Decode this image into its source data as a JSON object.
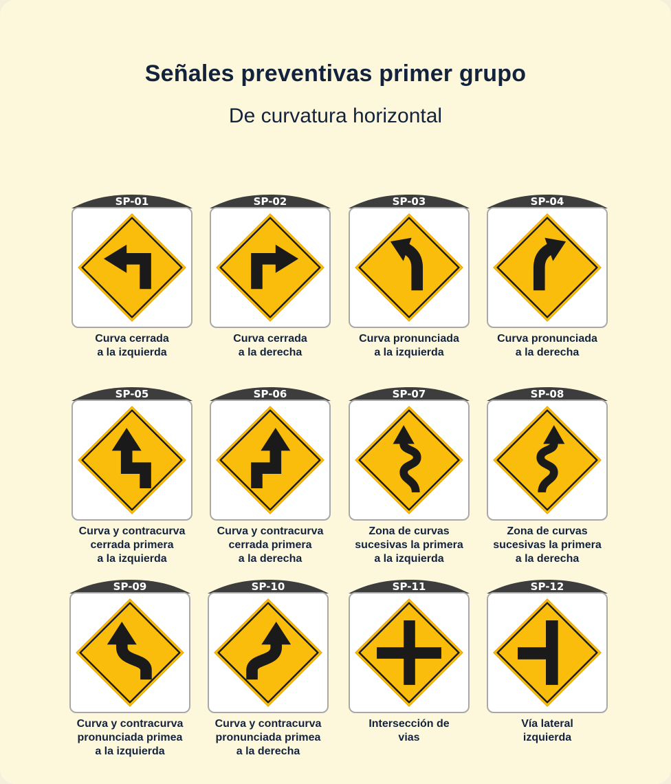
{
  "header": {
    "title": "Señales preventivas primer grupo",
    "subtitle": "De curvatura horizontal"
  },
  "colors": {
    "sign_yellow": "#fbbd0c",
    "sign_symbol": "#1a1a1a",
    "tab": "#3d3d3d",
    "background": "#fdf8db",
    "text": "#13233e"
  },
  "signs": [
    {
      "code": "SP-01",
      "caption_lines": [
        "Curva cerrada",
        "a la izquierda"
      ],
      "icon": "sharp-curve-left-icon"
    },
    {
      "code": "SP-02",
      "caption_lines": [
        "Curva cerrada",
        "a la derecha"
      ],
      "icon": "sharp-curve-right-icon"
    },
    {
      "code": "SP-03",
      "caption_lines": [
        "Curva pronunciada",
        "a la izquierda"
      ],
      "icon": "curve-left-icon"
    },
    {
      "code": "SP-04",
      "caption_lines": [
        "Curva pronunciada",
        "a la derecha"
      ],
      "icon": "curve-right-icon"
    },
    {
      "code": "SP-05",
      "caption_lines": [
        "Curva y contracurva",
        "cerrada primera",
        "a la izquierda"
      ],
      "icon": "reverse-turn-left-icon"
    },
    {
      "code": "SP-06",
      "caption_lines": [
        "Curva y contracurva",
        "cerrada primera",
        "a la derecha"
      ],
      "icon": "reverse-turn-right-icon"
    },
    {
      "code": "SP-07",
      "caption_lines": [
        "Zona de curvas",
        "sucesivas la primera",
        "a la izquierda"
      ],
      "icon": "winding-road-left-icon"
    },
    {
      "code": "SP-08",
      "caption_lines": [
        "Zona de curvas",
        "sucesivas la primera",
        "a la derecha"
      ],
      "icon": "winding-road-right-icon"
    },
    {
      "code": "SP-09",
      "caption_lines": [
        "Curva y contracurva",
        "pronunciada primea",
        "a la izquierda"
      ],
      "icon": "reverse-curve-left-icon"
    },
    {
      "code": "SP-10",
      "caption_lines": [
        "Curva y contracurva",
        "pronunciada primea",
        "a la derecha"
      ],
      "icon": "reverse-curve-right-icon"
    },
    {
      "code": "SP-11",
      "caption_lines": [
        "Intersección de",
        "vias"
      ],
      "icon": "crossroad-icon"
    },
    {
      "code": "SP-12",
      "caption_lines": [
        "Vía lateral",
        "izquierda"
      ],
      "icon": "side-road-left-icon"
    }
  ]
}
